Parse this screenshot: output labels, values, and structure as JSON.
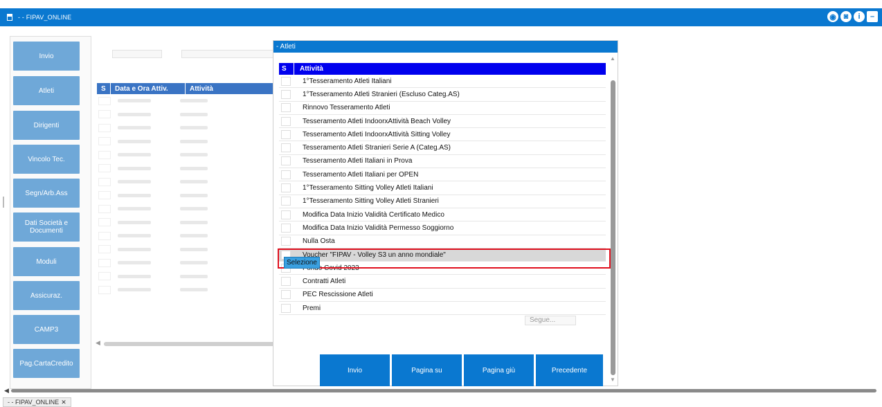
{
  "window": {
    "title": "- - FIPAV_ONLINE"
  },
  "window_icons": [
    "record-icon",
    "camera-icon",
    "info-icon",
    "minimize-icon"
  ],
  "sidebar": {
    "items": [
      {
        "label": "Invio"
      },
      {
        "label": "Atleti"
      },
      {
        "label": "Dirigenti"
      },
      {
        "label": "Vincolo Tec."
      },
      {
        "label": "Segn/Arb.Ass"
      },
      {
        "label": "Dati Società e Documenti"
      },
      {
        "label": "Moduli"
      },
      {
        "label": "Assicuraz."
      },
      {
        "label": "CAMP3"
      },
      {
        "label": "Pag.CartaCredito"
      }
    ]
  },
  "background_table": {
    "headers": [
      "S",
      "Data e Ora Attiv.",
      "Attività"
    ]
  },
  "dialog": {
    "title": "- Atleti",
    "headers": {
      "s": "S",
      "activity": "Attività"
    },
    "rows": [
      "1°Tesseramento Atleti Italiani",
      "1°Tesseramento Atleti Stranieri (Escluso Categ.AS)",
      "Rinnovo Tesseramento Atleti",
      "Tesseramento Atleti IndoorxAttività Beach Volley",
      "Tesseramento Atleti IndoorxAttività Sitting Volley",
      "Tesseramento Atleti Stranieri Serie A  (Categ.AS)",
      "Tesseramento Atleti Italiani in Prova",
      "Tesseramento Atleti Italiani per OPEN",
      "1°Tesseramento Sitting Volley Atleti Italiani",
      "1°Tesseramento Sitting Volley Atleti Stranieri",
      "Modifica Data Inizio Validità Certificato Medico",
      "Modifica Data Inizio Validità Permesso Soggiorno",
      "Nulla Osta",
      "Voucher \"FIPAV - Volley S3 un anno mondiale\"",
      "Fondo Covid 2023",
      "Contratti Atleti",
      "PEC Rescissione Atleti",
      "Premi"
    ],
    "tooltip": "Selezione",
    "more": "Segue...",
    "buttons": {
      "send": "Invio",
      "page_up": "Pagina su",
      "page_down": "Pagina giù",
      "previous": "Precedente"
    }
  },
  "taskbar": {
    "tab": "- - FIPAV_ONLINE",
    "close": "✕"
  }
}
